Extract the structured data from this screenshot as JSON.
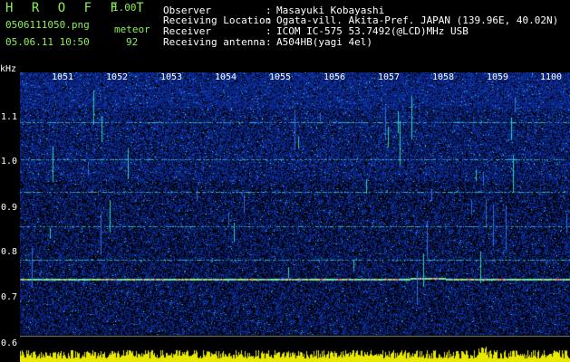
{
  "header": {
    "app_name": "H R O F F T",
    "version": "1.00",
    "file_name": "0506111050.png",
    "meteor_label": "meteor",
    "timestamp": "05.06.11 10:50",
    "meteor_count": "92"
  },
  "info": [
    {
      "label": "Observer",
      "value": "Masayuki Kobayashi"
    },
    {
      "label": "Receiving Location",
      "value": "Ogata-vill. Akita-Pref. JAPAN (139.96E, 40.02N)"
    },
    {
      "label": "Receiver",
      "value": "ICOM IC-575 53.7492(@LCD)MHz USB"
    },
    {
      "label": "Receiving antenna",
      "value": "A504HB(yagi 4el)"
    }
  ],
  "spectrogram": {
    "y_unit": "kHz",
    "y_ticks": [
      "1.1",
      "1.0",
      "0.9",
      "0.8",
      "0.7",
      "0.6"
    ],
    "x_ticks": [
      "1051",
      "1052",
      "1053",
      "1054",
      "1055",
      "1056",
      "1057",
      "1058",
      "1059",
      "1100"
    ],
    "colors": {
      "background": "#000000",
      "noise": "#1a2aa0",
      "signal": "#8ef05a",
      "histogram": "#e8e800"
    }
  }
}
